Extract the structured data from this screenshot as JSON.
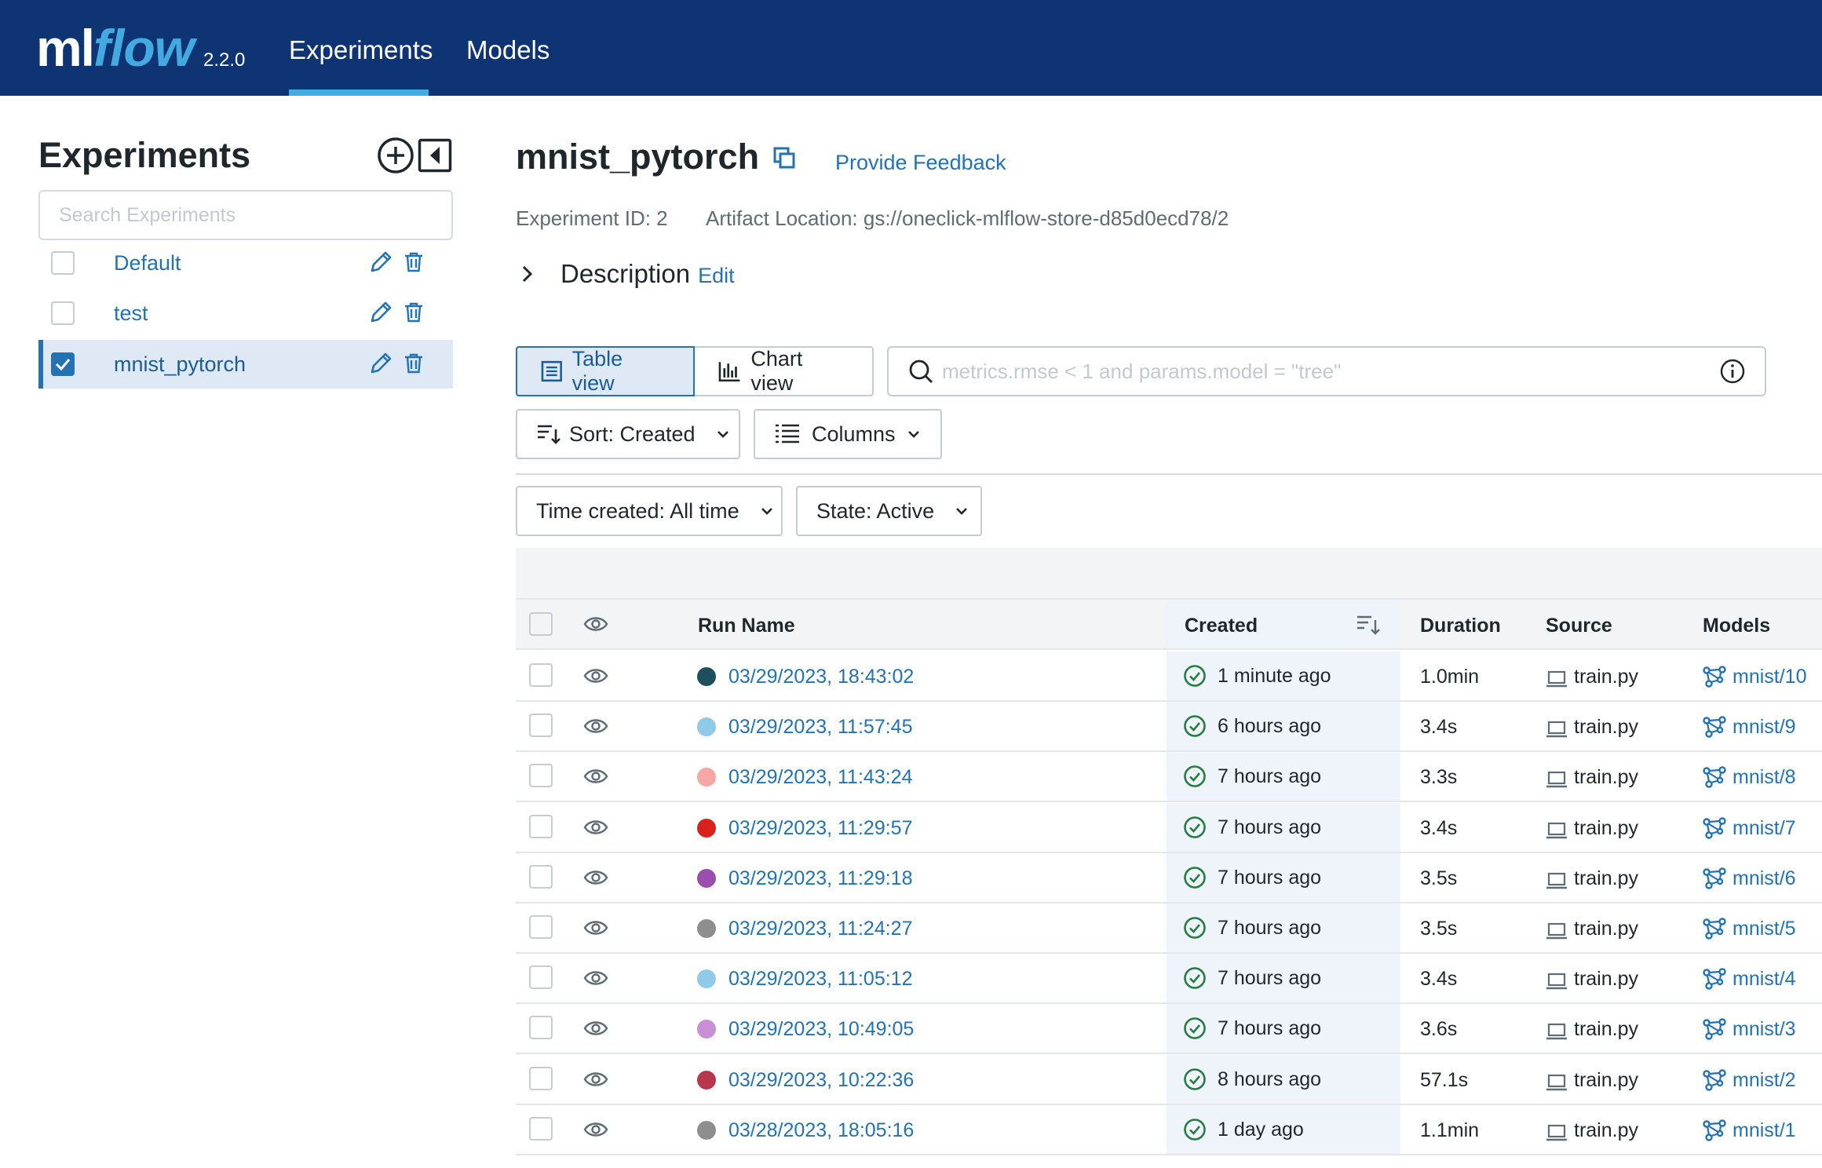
{
  "header": {
    "logo_ml": "ml",
    "logo_flow": "flow",
    "version": "2.2.0",
    "nav": [
      "Experiments",
      "Models"
    ],
    "active_nav": "Experiments"
  },
  "sidebar": {
    "title": "Experiments",
    "search_placeholder": "Search Experiments",
    "experiments": [
      {
        "name": "Default",
        "checked": false
      },
      {
        "name": "test",
        "checked": false
      },
      {
        "name": "mnist_pytorch",
        "checked": true
      }
    ]
  },
  "main": {
    "title": "mnist_pytorch",
    "feedback": "Provide Feedback",
    "experiment_id": "Experiment ID: 2",
    "artifact_location": "Artifact Location: gs://oneclick-mlflow-store-d85d0ecd78/2",
    "description_label": "Description",
    "description_edit": "Edit"
  },
  "controls": {
    "table_view": "Table view",
    "chart_view": "Chart view",
    "filter_placeholder": "metrics.rmse < 1 and params.model = \"tree\"",
    "sort": "Sort: Created",
    "columns": "Columns",
    "time_created": "Time created: All time",
    "state": "State: Active"
  },
  "table": {
    "headers": {
      "run_name": "Run Name",
      "created": "Created",
      "duration": "Duration",
      "source": "Source",
      "models": "Models"
    },
    "rows": [
      {
        "run_name": "03/29/2023, 18:43:02",
        "color": "#1d4f5c",
        "created": "1 minute ago",
        "duration": "1.0min",
        "source": "train.py",
        "model": "mnist/10"
      },
      {
        "run_name": "03/29/2023, 11:57:45",
        "color": "#8fcbe8",
        "created": "6 hours ago",
        "duration": "3.4s",
        "source": "train.py",
        "model": "mnist/9"
      },
      {
        "run_name": "03/29/2023, 11:43:24",
        "color": "#f4a7a3",
        "created": "7 hours ago",
        "duration": "3.3s",
        "source": "train.py",
        "model": "mnist/8"
      },
      {
        "run_name": "03/29/2023, 11:29:57",
        "color": "#d8201c",
        "created": "7 hours ago",
        "duration": "3.4s",
        "source": "train.py",
        "model": "mnist/7"
      },
      {
        "run_name": "03/29/2023, 11:29:18",
        "color": "#9a4fae",
        "created": "7 hours ago",
        "duration": "3.5s",
        "source": "train.py",
        "model": "mnist/6"
      },
      {
        "run_name": "03/29/2023, 11:24:27",
        "color": "#8e8e8e",
        "created": "7 hours ago",
        "duration": "3.5s",
        "source": "train.py",
        "model": "mnist/5"
      },
      {
        "run_name": "03/29/2023, 11:05:12",
        "color": "#8fcbe8",
        "created": "7 hours ago",
        "duration": "3.4s",
        "source": "train.py",
        "model": "mnist/4"
      },
      {
        "run_name": "03/29/2023, 10:49:05",
        "color": "#c98fd4",
        "created": "7 hours ago",
        "duration": "3.6s",
        "source": "train.py",
        "model": "mnist/3"
      },
      {
        "run_name": "03/29/2023, 10:22:36",
        "color": "#b8374f",
        "created": "8 hours ago",
        "duration": "57.1s",
        "source": "train.py",
        "model": "mnist/2"
      },
      {
        "run_name": "03/28/2023, 18:05:16",
        "color": "#8e8e8e",
        "created": "1 day ago",
        "duration": "1.1min",
        "source": "train.py",
        "model": "mnist/1"
      }
    ]
  },
  "colors": {
    "nav_bg": "#0e3474",
    "accent": "#43a9e1",
    "link": "#2272b4",
    "success": "#277c43"
  }
}
